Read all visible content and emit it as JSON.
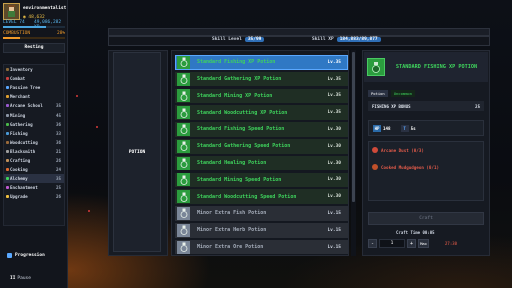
{
  "profile": {
    "username": "environmentalist",
    "gold": "48,632",
    "level": "LEVEL 74",
    "xp": "49,086,282 XP",
    "xp_fraction": 0.7,
    "action": "COMBUSTION",
    "action_pct": "28%",
    "action_fraction": 0.28,
    "status": "Resting"
  },
  "nav": [
    {
      "label": "Inventory",
      "level": "",
      "color": "#8a6a3a"
    },
    {
      "label": "Combat",
      "level": "",
      "color": "#c94040"
    },
    {
      "label": "Passive Tree",
      "level": "",
      "color": "#5aa8ff"
    },
    {
      "label": "Merchant",
      "level": "",
      "color": "#e0a030"
    },
    {
      "label": "Arcane School",
      "level": "35",
      "color": "#9a5ad0"
    },
    {
      "label": "Mining",
      "level": "45",
      "color": "#8c96a6"
    },
    {
      "label": "Gathering",
      "level": "36",
      "color": "#4ab84a"
    },
    {
      "label": "Fishing",
      "level": "33",
      "color": "#4a9ad8"
    },
    {
      "label": "Woodcutting",
      "level": "36",
      "color": "#9a6a3a"
    },
    {
      "label": "Blacksmith",
      "level": "21",
      "color": "#a0a0a0"
    },
    {
      "label": "Crafting",
      "level": "26",
      "color": "#c0905a"
    },
    {
      "label": "Cooking",
      "level": "24",
      "color": "#e06a30"
    },
    {
      "label": "Alchemy",
      "level": "35",
      "color": "#3fd45d",
      "active": true
    },
    {
      "label": "Enchantment",
      "level": "25",
      "color": "#c05ad0"
    },
    {
      "label": "Upgrade",
      "level": "26",
      "color": "#f0c040"
    }
  ],
  "progression_label": "Progression",
  "pause": {
    "icon": "II",
    "label": "Pause"
  },
  "header": {
    "skill_level_label": "Skill Level",
    "skill_level_value": "35/99",
    "skill_xp_label": "Skill XP",
    "skill_xp_value": "184,883/89,877"
  },
  "category": {
    "label": "POTION"
  },
  "recipes": [
    {
      "name": "Standard Fishing XP Potion",
      "level": "Lv.35",
      "state": "sel"
    },
    {
      "name": "Standard Gathering XP Potion",
      "level": "Lv.35",
      "state": "green"
    },
    {
      "name": "Standard Mining XP Potion",
      "level": "Lv.35",
      "state": "green"
    },
    {
      "name": "Standard Woodcutting XP Potion",
      "level": "Lv.35",
      "state": "green"
    },
    {
      "name": "Standard Fishing Speed Potion",
      "level": "Lv.30",
      "state": "green"
    },
    {
      "name": "Standard Gathering Speed Potion",
      "level": "Lv.30",
      "state": "green"
    },
    {
      "name": "Standard Healing Potion",
      "level": "Lv.30",
      "state": "green"
    },
    {
      "name": "Standard Mining Speed Potion",
      "level": "Lv.30",
      "state": "green"
    },
    {
      "name": "Standard Woodcutting Speed Potion",
      "level": "Lv.30",
      "state": "green"
    },
    {
      "name": "Minor Extra Fish Potion",
      "level": "Lv.15",
      "state": "grey"
    },
    {
      "name": "Minor Extra Herb Potion",
      "level": "Lv.15",
      "state": "grey"
    },
    {
      "name": "Minor Extra Ore Potion",
      "level": "Lv.15",
      "state": "grey"
    }
  ],
  "detail": {
    "title": "STANDARD FISHING XP POTION",
    "tab_type": "Potion",
    "tab_rarity": "Uncommon",
    "bonus_label": "FISHING XP BONUS",
    "bonus_value": "25",
    "hp_badge": "HP",
    "hp_value": "148",
    "t_badge": "T",
    "t_value": "5s",
    "ingredients": [
      {
        "label": "Arcane Dust (0/3)",
        "color": "#d04a3a"
      },
      {
        "label": "Cooked Mudgudgeon (0/1)",
        "color": "#c0502a"
      }
    ],
    "craft_label": "Craft",
    "craft_time": "Craft Time 00:05",
    "qty_minus": "-",
    "qty_value": "1",
    "qty_plus": "+",
    "qty_max": "Max",
    "qty_time": "27:30"
  }
}
